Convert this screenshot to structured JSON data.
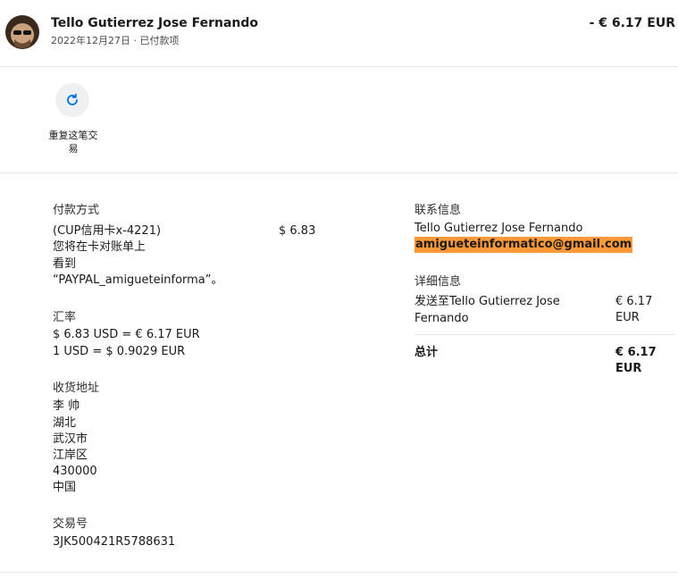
{
  "header": {
    "name": "Tello Gutierrez Jose Fernando",
    "subtitle": "2022年12月27日 · 已付款项",
    "amount": "- € 6.17 EUR"
  },
  "actions": {
    "repeat_label": "重复这笔交易"
  },
  "payment": {
    "title": "付款方式",
    "method": "(CUP信用卡x-4221)",
    "amount": "$ 6.83",
    "note_lines": [
      "您将在卡对账单上",
      "看到",
      "“PAYPAL_amigueteinforma”。"
    ]
  },
  "exchange": {
    "title": "汇率",
    "line1": "$ 6.83 USD = € 6.17 EUR",
    "line2": "1 USD = $ 0.9029 EUR"
  },
  "shipping": {
    "title": "收货地址",
    "lines": [
      "李 帅",
      "湖北",
      "武汉市",
      "江岸区",
      "430000",
      "中国"
    ]
  },
  "transaction": {
    "title": "交易号",
    "id": "3JK500421R5788631"
  },
  "contact": {
    "title": "联系信息",
    "name": "Tello Gutierrez Jose Fernando",
    "email": "amigueteinformatico@gmail.com"
  },
  "details": {
    "title": "详细信息",
    "sent_to_line1": "发送至Tello Gutierrez Jose",
    "sent_to_line2": "Fernando",
    "sent_amount": "€ 6.17 EUR",
    "total_label": "总计",
    "total_amount": "€ 6.17 EUR"
  },
  "colors": {
    "accent": "#0070e0",
    "highlight": "#ff9838"
  }
}
